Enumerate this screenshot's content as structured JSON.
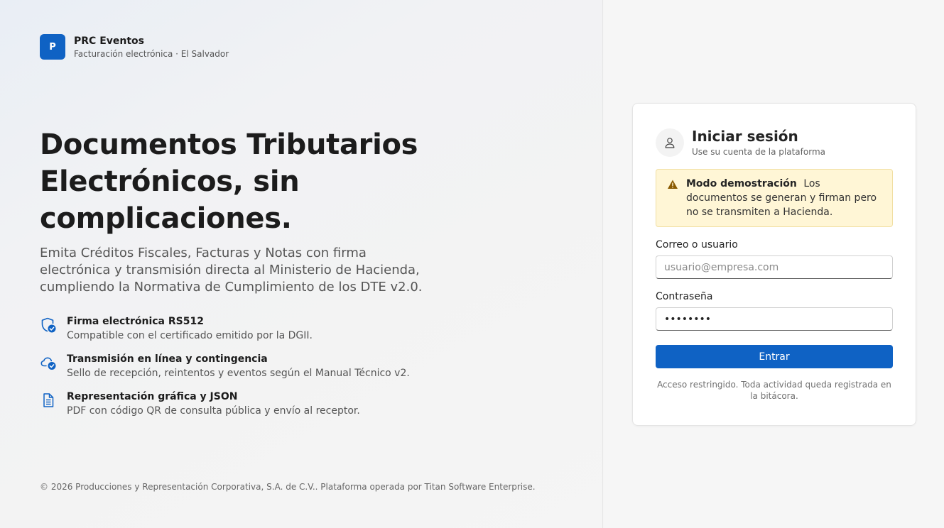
{
  "brand": {
    "initial": "P",
    "name": "PRC Eventos",
    "subtitle": "Facturación electrónica · El Salvador"
  },
  "hero": {
    "title": "Documentos Tributarios Electrónicos, sin complicaciones.",
    "description": "Emita Créditos Fiscales, Facturas y Notas con firma electrónica y transmisión directa al Ministerio de Hacienda, cumpliendo la Normativa de Cumplimiento de los DTE v2.0."
  },
  "features": [
    {
      "icon": "shield-check-icon",
      "title": "Firma electrónica RS512",
      "description": "Compatible con el certificado emitido por la DGII."
    },
    {
      "icon": "cloud-check-icon",
      "title": "Transmisión en línea y contingencia",
      "description": "Sello de recepción, reintentos y eventos según el Manual Técnico v2."
    },
    {
      "icon": "document-icon",
      "title": "Representación gráfica y JSON",
      "description": "PDF con código QR de consulta pública y envío al receptor."
    }
  ],
  "footer": "© 2026 Producciones y Representación Corporativa, S.A. de C.V.. Plataforma operada por Titan Software Enterprise.",
  "login": {
    "title": "Iniciar sesión",
    "subtitle": "Use su cuenta de la plataforma",
    "alert": {
      "title": "Modo demostración",
      "text": "Los documentos se generan y firman pero no se transmiten a Hacienda."
    },
    "user_label": "Correo o usuario",
    "user_placeholder": "usuario@empresa.com",
    "user_value": "",
    "password_label": "Contraseña",
    "password_value": "••••••••",
    "submit_label": "Entrar",
    "note": "Acceso restringido. Toda actividad queda registrada en la bitácora."
  },
  "colors": {
    "accent": "#0f62c4",
    "alert_bg": "#fff6d6",
    "alert_icon": "#8a5a00"
  }
}
